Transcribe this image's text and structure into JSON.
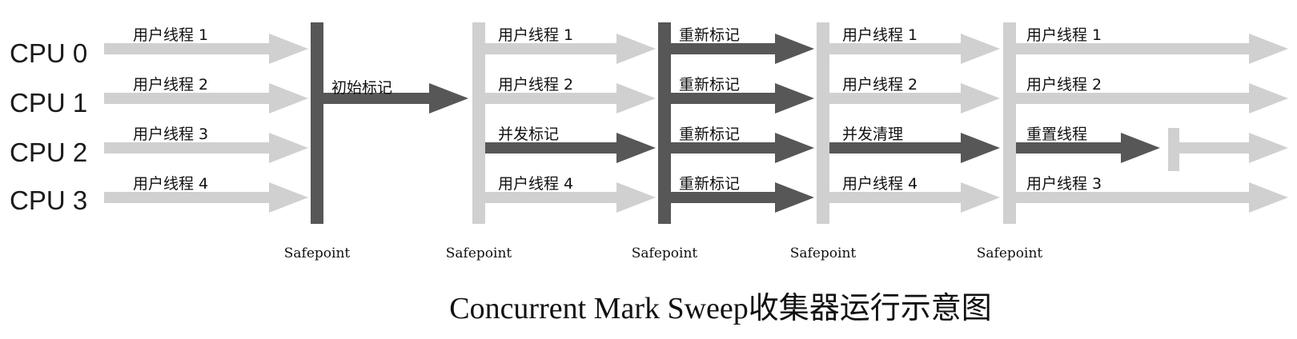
{
  "colors": {
    "light": "#d0d0d0",
    "dark": "#575757",
    "text": "#111111"
  },
  "cpus": [
    "CPU 0",
    "CPU 1",
    "CPU 2",
    "CPU 3"
  ],
  "phases": [
    {
      "lanes": [
        {
          "label": "用户线程 1",
          "style": "light"
        },
        {
          "label": "用户线程 2",
          "style": "light"
        },
        {
          "label": "用户线程 3",
          "style": "light"
        },
        {
          "label": "用户线程 4",
          "style": "light"
        }
      ]
    },
    {
      "lanes": [
        {
          "label": "初始标记",
          "style": "dark"
        }
      ]
    },
    {
      "lanes": [
        {
          "label": "用户线程 1",
          "style": "light"
        },
        {
          "label": "用户线程 2",
          "style": "light"
        },
        {
          "label": "并发标记",
          "style": "dark"
        },
        {
          "label": "用户线程 4",
          "style": "light"
        }
      ]
    },
    {
      "lanes": [
        {
          "label": "重新标记",
          "style": "dark"
        },
        {
          "label": "重新标记",
          "style": "dark"
        },
        {
          "label": "重新标记",
          "style": "dark"
        },
        {
          "label": "重新标记",
          "style": "dark"
        }
      ]
    },
    {
      "lanes": [
        {
          "label": "用户线程 1",
          "style": "light"
        },
        {
          "label": "用户线程 2",
          "style": "light"
        },
        {
          "label": "并发清理",
          "style": "dark"
        },
        {
          "label": "用户线程 4",
          "style": "light"
        }
      ]
    },
    {
      "lanes": [
        {
          "label": "用户线程 1",
          "style": "light"
        },
        {
          "label": "用户线程 2",
          "style": "light"
        },
        {
          "label": "重置线程",
          "style": "dark"
        },
        {
          "label": "用户线程 3",
          "style": "light"
        }
      ]
    }
  ],
  "safepoints": [
    "Safepoint",
    "Safepoint",
    "Safepoint",
    "Safepoint",
    "Safepoint"
  ],
  "caption": "Concurrent Mark Sweep收集器运行示意图"
}
